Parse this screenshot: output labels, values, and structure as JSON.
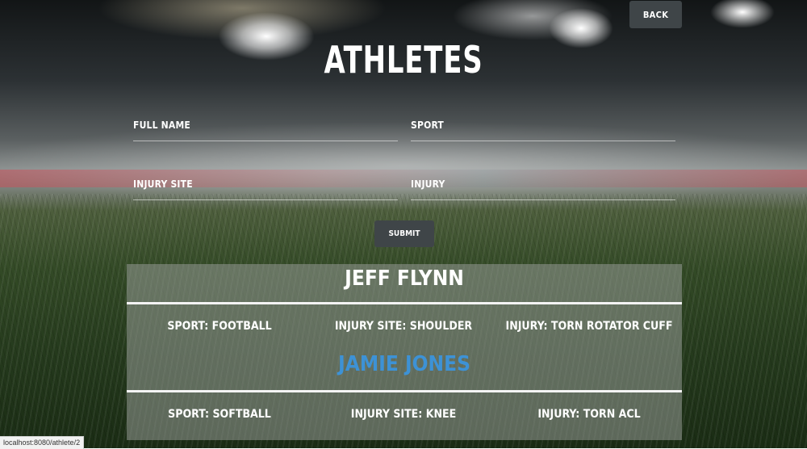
{
  "header": {
    "back_label": "BACK",
    "title": "ATHLETES"
  },
  "form": {
    "full_name_label": "FULL NAME",
    "sport_label": "SPORT",
    "injury_site_label": "INJURY SITE",
    "injury_label": "INJURY",
    "submit_label": "SUBMIT"
  },
  "athletes": [
    {
      "name": "JEFF FLYNN",
      "sport": "SPORT: FOOTBALL",
      "injury_site": "INJURY SITE: SHOULDER",
      "injury": "INJURY: TORN ROTATOR CUFF",
      "name_color": "#ffffff"
    },
    {
      "name": "JAMIE JONES",
      "sport": "SPORT: SOFTBALL",
      "injury_site": "INJURY SITE: KNEE",
      "injury": "INJURY: TORN ACL",
      "name_color": "#3d92d6"
    }
  ],
  "status_bar": {
    "url": "localhost:8080/athlete/2"
  },
  "colors": {
    "button_bg": "#3f4548",
    "link_hover": "#3d92d6"
  }
}
